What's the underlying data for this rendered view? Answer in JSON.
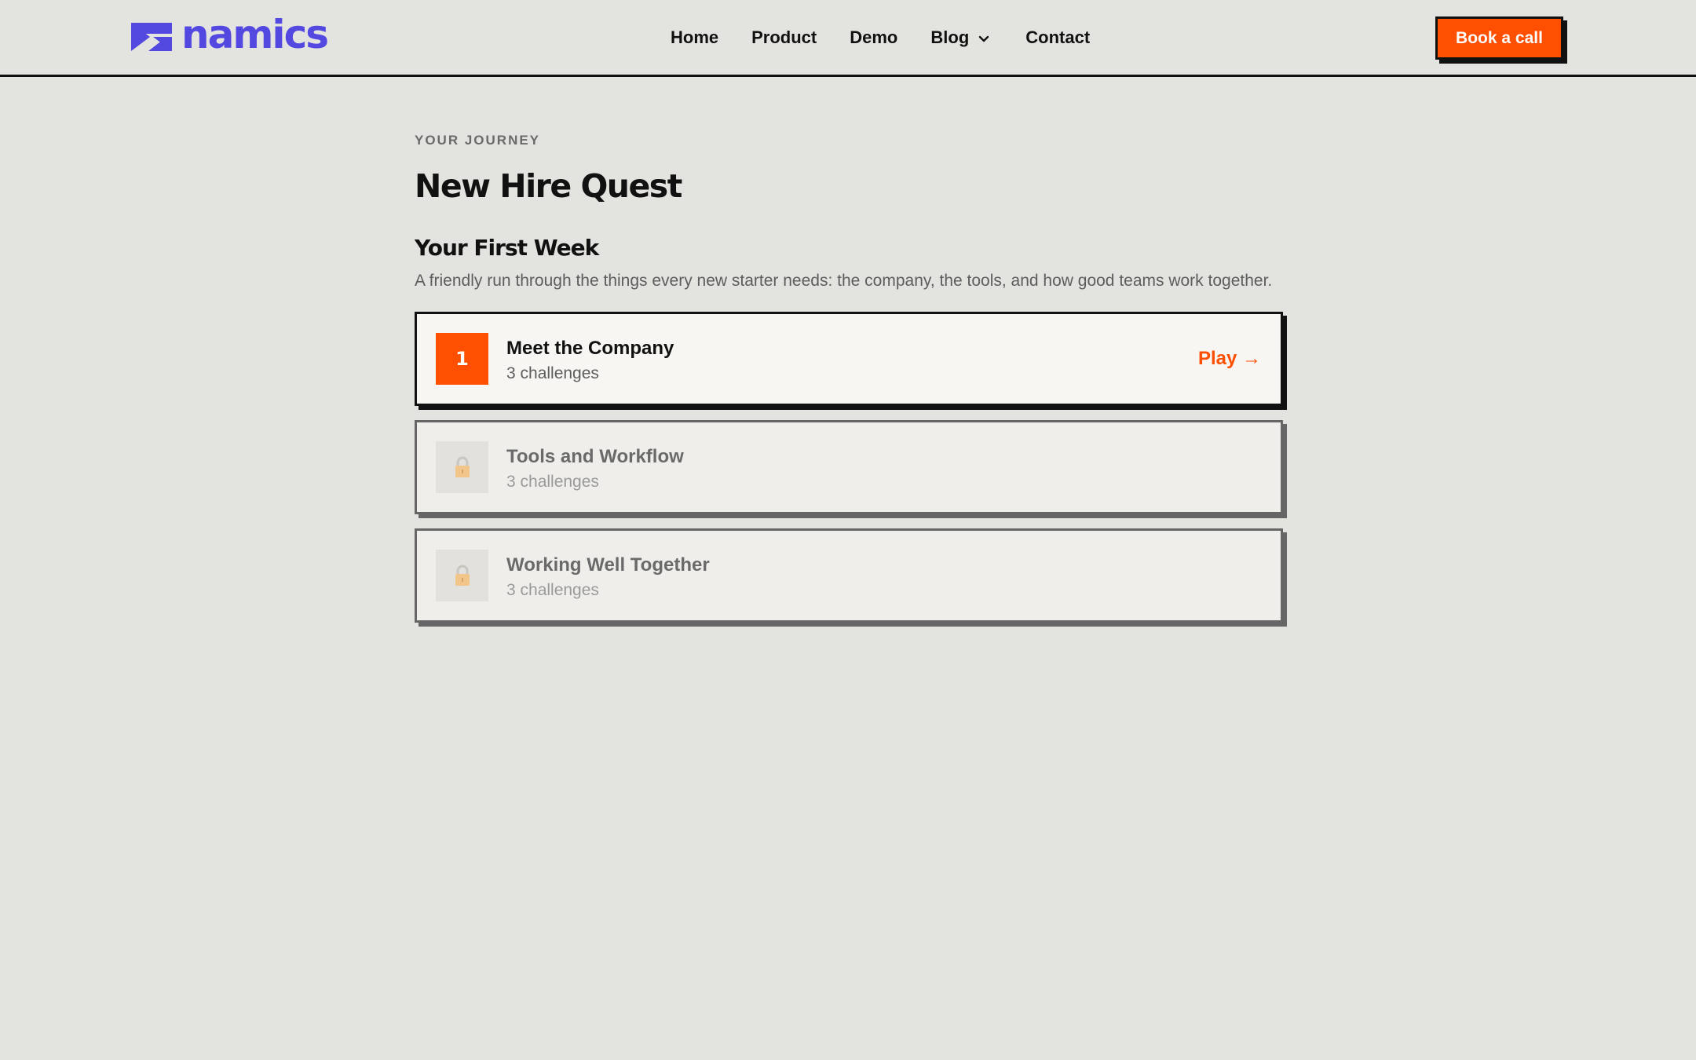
{
  "brand": {
    "name": "namics",
    "color": "#5348e0"
  },
  "nav": {
    "items": [
      {
        "label": "Home"
      },
      {
        "label": "Product"
      },
      {
        "label": "Demo"
      },
      {
        "label": "Blog",
        "has_dropdown": true
      },
      {
        "label": "Contact"
      }
    ],
    "cta_label": "Book a call"
  },
  "main": {
    "eyebrow": "YOUR JOURNEY",
    "title": "New Hire Quest",
    "section": {
      "title": "Your First Week",
      "description": "A friendly run through the things every new starter needs: the company, the tools, and how good teams work together."
    },
    "levels": [
      {
        "number": "1",
        "title": "Meet the Company",
        "subtitle": "3 challenges",
        "status": "unlocked",
        "action_label": "Play →"
      },
      {
        "icon": "lock-icon",
        "title": "Tools and Workflow",
        "subtitle": "3 challenges",
        "status": "locked"
      },
      {
        "icon": "lock-icon",
        "title": "Working Well Together",
        "subtitle": "3 challenges",
        "status": "locked"
      }
    ]
  },
  "colors": {
    "accent": "#ff4f00",
    "background": "#e3e3df",
    "ink": "#111111"
  }
}
